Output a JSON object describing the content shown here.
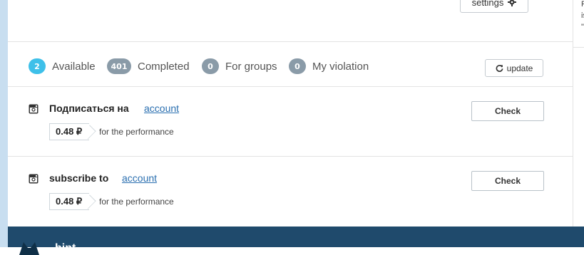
{
  "top": {
    "settings_label": "settings"
  },
  "right_column": {
    "lines": [
      "F",
      "is",
      "\""
    ]
  },
  "tabs": [
    {
      "count": "2",
      "label": "Available"
    },
    {
      "count": "401",
      "label": "Completed"
    },
    {
      "count": "0",
      "label": "For groups"
    },
    {
      "count": "0",
      "label": "My violation"
    }
  ],
  "update_label": "update",
  "tasks": [
    {
      "title": "Подписаться на",
      "account": "account",
      "price": "0.48 ₽",
      "perf": "for the performance",
      "check": "Check"
    },
    {
      "title": "subscribe to",
      "account": "account",
      "price": "0.48 ₽",
      "perf": "for the performance",
      "check": "Check"
    }
  ],
  "footer": {
    "text": "hint"
  },
  "colors": {
    "accent_badge": "#3ec0e9",
    "muted_badge": "#8a9ba8",
    "footer_bg": "#1f4a6c",
    "link": "#2a6fb0"
  },
  "icons": {
    "settings": "gear-icon",
    "update": "refresh-icon",
    "task": "instagram-icon"
  }
}
